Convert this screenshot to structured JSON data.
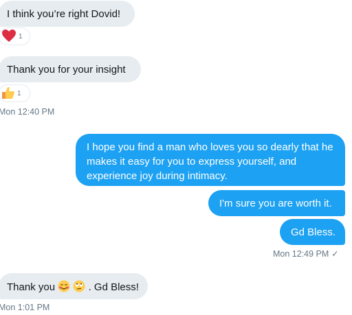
{
  "messages": [
    {
      "text": "I think you’re right Dovid!",
      "reaction": {
        "icon": "red-heart-icon",
        "count": "1"
      }
    },
    {
      "text": "Thank you for your insight",
      "reaction": {
        "icon": "thumbs-up-icon",
        "count": "1"
      }
    },
    {
      "timestamp": "Mon 12:40 PM"
    },
    {
      "text": "I hope you find a man who loves you so dearly that he makes it easy for you to express yourself, and experience joy during intimacy."
    },
    {
      "text": "I'm sure you are worth it."
    },
    {
      "text": "Gd Bless."
    },
    {
      "timestamp": "Mon 12:49 PM",
      "status": "✓"
    },
    {
      "text_before": "Thank you ",
      "emojis": [
        "smiling-face-with-hearts-icon",
        "face-with-rolling-eyes-icon"
      ],
      "text_after": ". Gd Bless!"
    },
    {
      "timestamp": "Mon 1:01 PM"
    }
  ],
  "colors": {
    "incoming_bubble": "#e6ecf0",
    "outgoing_bubble": "#1da1f2",
    "timestamp_text": "#657786"
  }
}
